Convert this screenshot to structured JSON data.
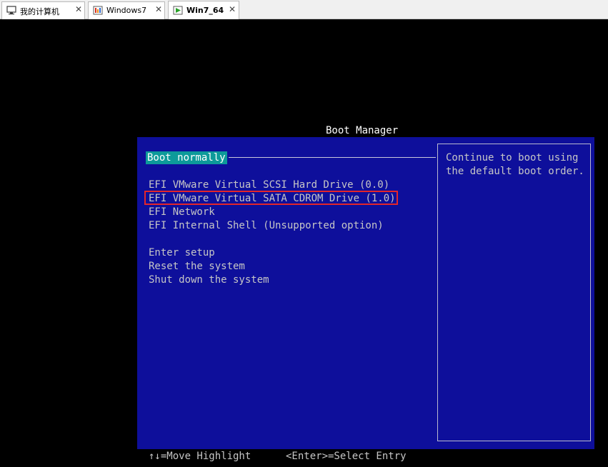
{
  "tabs": [
    {
      "label": "我的计算机",
      "close": "✕",
      "icon": "computer-icon"
    },
    {
      "label": "Windows7",
      "close": "✕",
      "icon": "vm-icon"
    },
    {
      "label": "Win7_64",
      "close": "✕",
      "icon": "vm-running-icon"
    }
  ],
  "boot_manager": {
    "title": "Boot Manager",
    "items": [
      "Boot normally",
      "EFI VMware Virtual SCSI Hard Drive (0.0)",
      "EFI VMware Virtual SATA CDROM Drive (1.0)",
      "EFI Network",
      "EFI Internal Shell (Unsupported option)",
      "Enter setup",
      "Reset the system",
      "Shut down the system"
    ],
    "help": "Continue to boot using\nthe default boot order.",
    "footer": {
      "move": "↑↓=Move Highlight",
      "select": "<Enter>=Select Entry"
    }
  },
  "colors": {
    "panel": "#0e0f9b",
    "selected": "#0d9a9a",
    "annotation": "#e3262a"
  }
}
